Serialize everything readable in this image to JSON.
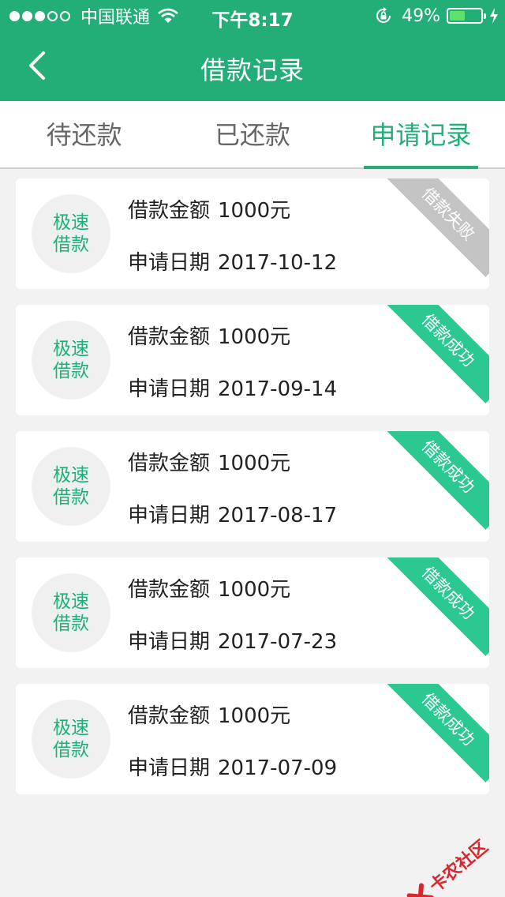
{
  "status": {
    "carrier": "中国联通",
    "time": "下午8:17",
    "battery": "49%",
    "battery_level": 0.49
  },
  "nav": {
    "title": "借款记录",
    "back_icon": "chevron-left-icon"
  },
  "tabs": [
    {
      "label": "待还款",
      "active": false
    },
    {
      "label": "已还款",
      "active": false
    },
    {
      "label": "申请记录",
      "active": true
    }
  ],
  "records": [
    {
      "badge_line1": "极速",
      "badge_line2": "借款",
      "amount_label": "借款金额",
      "amount": "1000元",
      "date_label": "申请日期",
      "date": "2017-10-12",
      "status": "借款失败",
      "status_kind": "failed"
    },
    {
      "badge_line1": "极速",
      "badge_line2": "借款",
      "amount_label": "借款金额",
      "amount": "1000元",
      "date_label": "申请日期",
      "date": "2017-09-14",
      "status": "借款成功",
      "status_kind": "success"
    },
    {
      "badge_line1": "极速",
      "badge_line2": "借款",
      "amount_label": "借款金额",
      "amount": "1000元",
      "date_label": "申请日期",
      "date": "2017-08-17",
      "status": "借款成功",
      "status_kind": "success"
    },
    {
      "badge_line1": "极速",
      "badge_line2": "借款",
      "amount_label": "借款金额",
      "amount": "1000元",
      "date_label": "申请日期",
      "date": "2017-07-23",
      "status": "借款成功",
      "status_kind": "success"
    },
    {
      "badge_line1": "极速",
      "badge_line2": "借款",
      "amount_label": "借款金额",
      "amount": "1000元",
      "date_label": "申请日期",
      "date": "2017-07-09",
      "status": "借款成功",
      "status_kind": "success"
    }
  ],
  "colors": {
    "primary": "#23ae77",
    "ribbon_success": "#2cc891",
    "ribbon_failed": "#c4c4c4",
    "watermark": "#d9252b"
  },
  "watermark": {
    "text": "卡农社区"
  }
}
